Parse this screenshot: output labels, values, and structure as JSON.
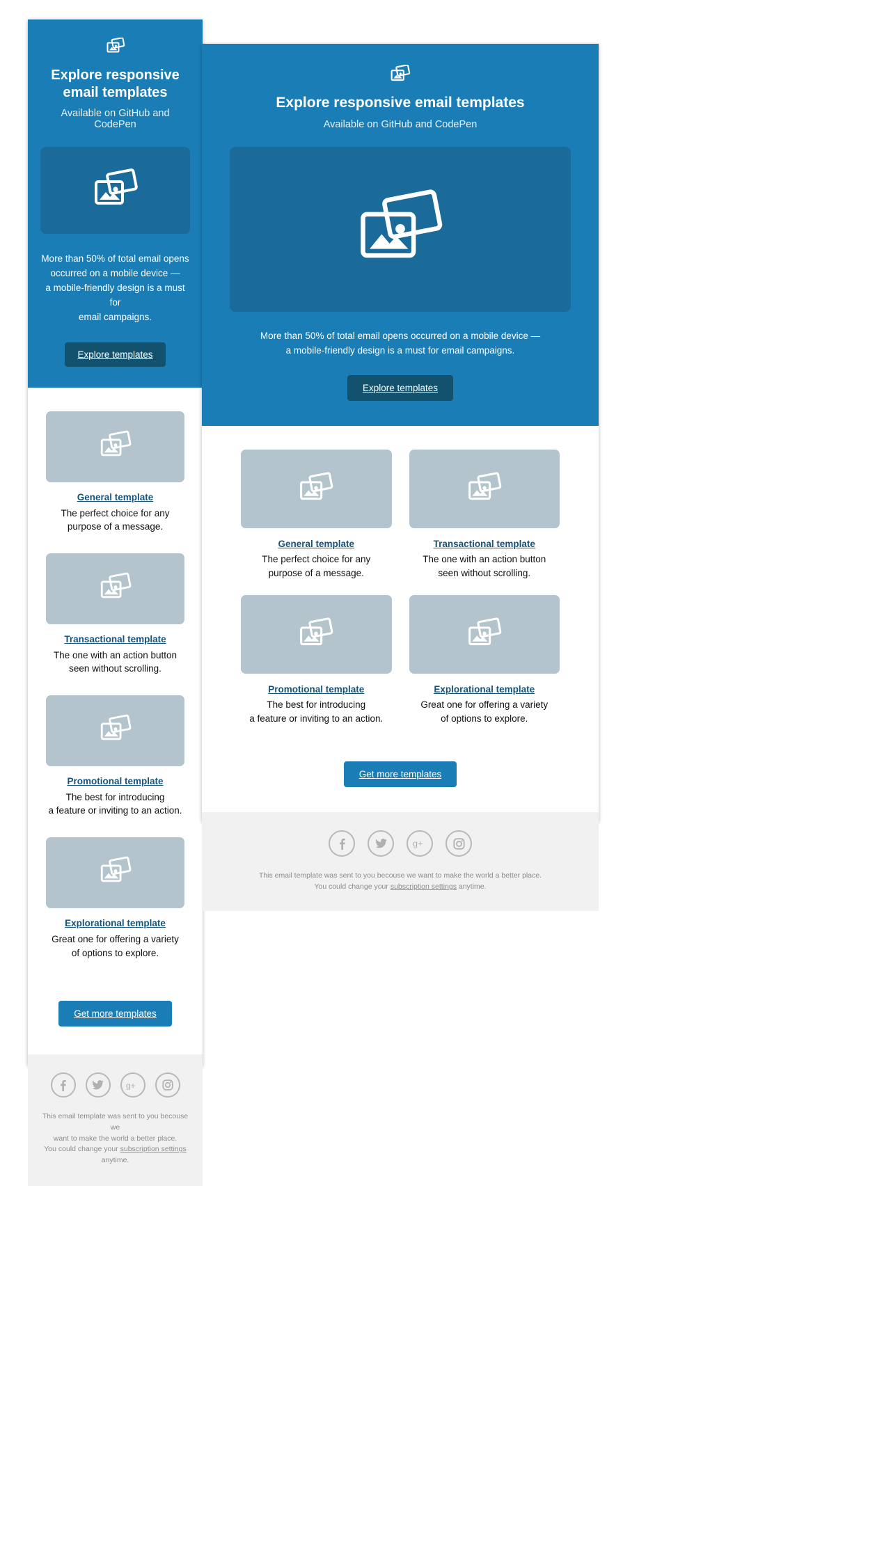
{
  "brand": {
    "hero_bg": "#1a7db5",
    "hero_image_bg": "#1a6b99",
    "button_dark_bg": "#12526e",
    "button_blue_bg": "#1a7db5",
    "card_thumb_bg": "#b3c4cd",
    "link_color": "#15537a",
    "footer_bg": "#f1f1f1",
    "footer_text_color": "#8c8c8c"
  },
  "hero": {
    "logo_icon": "photo-stack-icon",
    "title": "Explore responsive email templates",
    "subtitle": "Available on GitHub and CodePen",
    "image_icon": "photo-stack-icon",
    "body": "More than 50% of total email opens occurred on a mobile device — a mobile-friendly design is a must for email campaigns.",
    "body_mobile_line1": "More than 50% of total email opens",
    "body_mobile_line2": "occurred on a mobile device —",
    "body_mobile_line3": "a mobile-friendly design is a must for",
    "body_mobile_line4": "email campaigns.",
    "body_desktop_line1": "More than 50% of total email opens occurred on a mobile device —",
    "body_desktop_line2": "a mobile-friendly design is a must for email campaigns.",
    "cta_label": "Explore templates"
  },
  "cards": [
    {
      "icon": "photo-stack-icon",
      "title": "General template",
      "desc_line1": "The perfect choice for any",
      "desc_line2": "purpose of a message."
    },
    {
      "icon": "photo-stack-icon",
      "title": "Transactional template",
      "desc_line1": "The one with an action button",
      "desc_line2": "seen without scrolling."
    },
    {
      "icon": "photo-stack-icon",
      "title": "Promotional template",
      "desc_line1": "The best for introducing",
      "desc_line2": "a feature or inviting to an action."
    },
    {
      "icon": "photo-stack-icon",
      "title": "Explorational template",
      "desc_line1": "Great one for offering a variety",
      "desc_line2": "of options to explore."
    }
  ],
  "more_cta": {
    "label": "Get more templates"
  },
  "footer": {
    "social": [
      {
        "name": "facebook-icon",
        "glyph": "f"
      },
      {
        "name": "twitter-icon",
        "glyph": "t"
      },
      {
        "name": "google-plus-icon",
        "glyph": "g+"
      },
      {
        "name": "instagram-icon",
        "glyph": "ig"
      }
    ],
    "note_mobile_line1": "This email template was sent to you becouse we",
    "note_mobile_line2": "want to make the world a better place.",
    "note_mobile_line3_pre": "You could change your ",
    "note_link": "subscription settings",
    "note_mobile_line3_post": "",
    "note_mobile_line4": "anytime.",
    "note_desktop_line1": "This email template was sent to you becouse we want to make the world a better place.",
    "note_desktop_line2_pre": "You could change your ",
    "note_desktop_line2_post": " anytime."
  }
}
